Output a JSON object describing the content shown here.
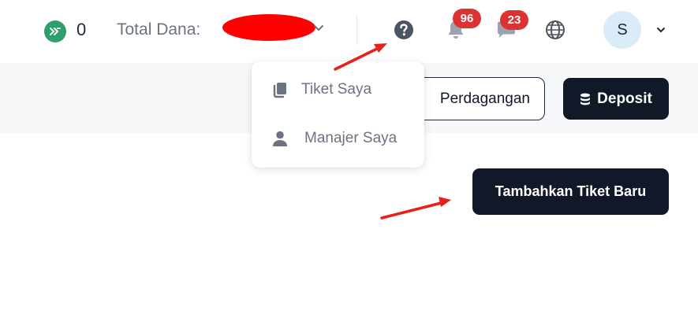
{
  "header": {
    "points_value": "0",
    "total_funds_label": "Total Dana:",
    "notifications_count": "96",
    "messages_count": "23",
    "avatar_initial": "S"
  },
  "actions": {
    "trading_label": "Perdagangan",
    "deposit_label": "Deposit",
    "new_ticket_label": "Tambahkan Tiket Baru"
  },
  "help_menu": {
    "items": [
      {
        "label": "Tiket Saya",
        "icon": "copy-icon"
      },
      {
        "label": "Manajer Saya",
        "icon": "person-icon"
      }
    ]
  },
  "annotations": {
    "arrow_color": "#e8201a",
    "redaction_color": "#ff0000"
  },
  "colors": {
    "dark_button": "#111827",
    "badge": "#dc3232",
    "points_icon": "#2f9e6d",
    "avatar_bg": "#d9ecf7"
  }
}
